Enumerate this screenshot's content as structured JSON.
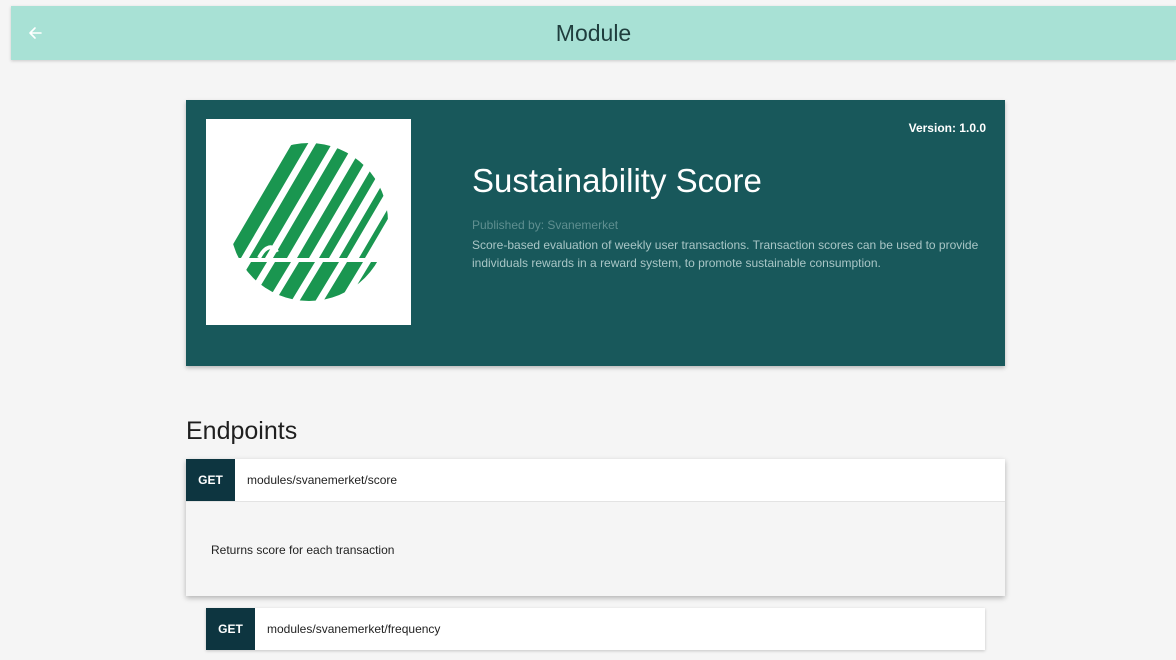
{
  "header": {
    "title": "Module",
    "back_icon": "arrow-left-icon",
    "background": "#a8e1d5"
  },
  "module": {
    "name": "Sustainability Score",
    "version_label": "Version: 1.0.0",
    "publisher_label": "Published by: Svanemerket",
    "description": "Score-based evaluation of weekly user transactions. Transaction scores can be used to provide individuals rewards in a reward system, to promote sustainable consumption.",
    "logo_icon": "swan-ecolabel-logo",
    "card_color": "#18585b",
    "logo_color": "#1a9650"
  },
  "endpoints_section": {
    "title": "Endpoints",
    "items": [
      {
        "method": "GET",
        "path": "modules/svanemerket/score",
        "expanded": true,
        "description": "Returns score for each transaction"
      },
      {
        "method": "GET",
        "path": "modules/svanemerket/frequency",
        "expanded": false
      }
    ]
  }
}
